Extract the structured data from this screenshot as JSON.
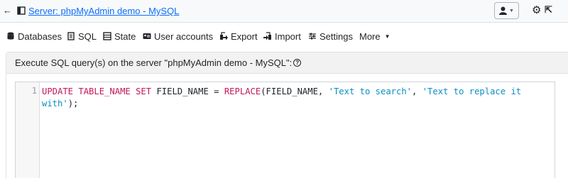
{
  "breadcrumb": {
    "server_label": "Server: phpMyAdmin demo - MySQL"
  },
  "nav": {
    "items": [
      {
        "label": "Databases",
        "icon": "database-icon"
      },
      {
        "label": "SQL",
        "icon": "sql-icon"
      },
      {
        "label": "State",
        "icon": "status-icon"
      },
      {
        "label": "User accounts",
        "icon": "users-icon"
      },
      {
        "label": "Export",
        "icon": "export-icon"
      },
      {
        "label": "Import",
        "icon": "import-icon"
      },
      {
        "label": "Settings",
        "icon": "settings-icon"
      },
      {
        "label": "More",
        "icon": "caret-down-icon"
      }
    ]
  },
  "panel": {
    "title": "Execute SQL query(s) on the server \"phpMyAdmin demo - MySQL\":"
  },
  "editor": {
    "line_number": "1",
    "tokens": {
      "kw1": "UPDATE",
      "t1": " ",
      "kw2": "TABLE_NAME",
      "t2": " ",
      "kw3": "SET",
      "t3": " FIELD_NAME = ",
      "kw4": "REPLACE",
      "t4": "(FIELD_NAME, ",
      "s1": "'Text to search'",
      "t5": ", ",
      "s2": "'Text to replace it with'",
      "t6": ");"
    }
  },
  "colors": {
    "keyword": "#c2185b",
    "string": "#0b8ec4",
    "link": "#0d6efd"
  }
}
